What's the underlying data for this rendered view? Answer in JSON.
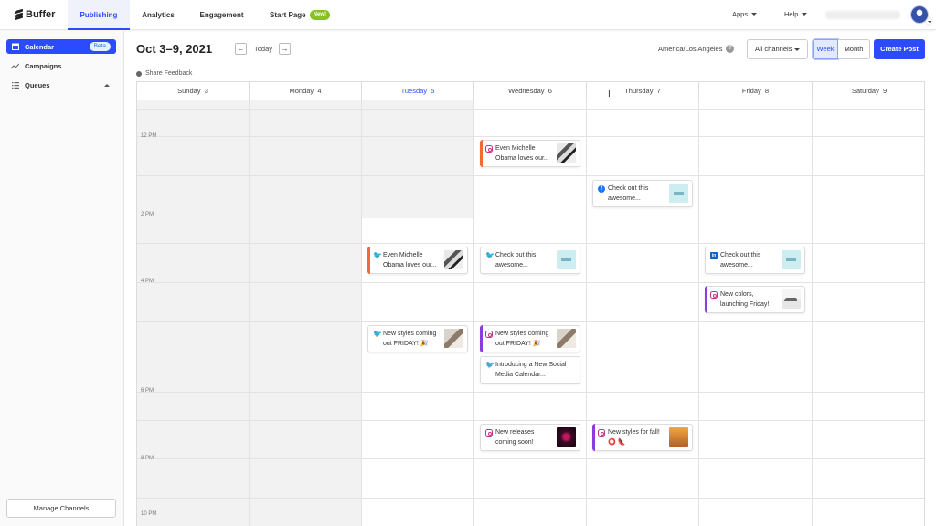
{
  "nav": {
    "logo": "Buffer",
    "tabs": [
      "Publishing",
      "Analytics",
      "Engagement",
      "Start Page"
    ],
    "new_badge": "New!",
    "apps": "Apps",
    "help": "Help"
  },
  "sidebar": {
    "items": [
      {
        "label": "Calendar",
        "badge": "Beta"
      },
      {
        "label": "Campaigns"
      },
      {
        "label": "Queues"
      }
    ],
    "manage": "Manage Channels"
  },
  "header": {
    "date_range": "Oct 3–9, 2021",
    "prev": "←",
    "next": "→",
    "today": "Today",
    "timezone": "America/Los Angeles",
    "channels": "All channels",
    "week": "Week",
    "month": "Month",
    "create": "Create Post",
    "feedback": "Share Feedback"
  },
  "days": [
    {
      "name": "Sunday",
      "num": "3"
    },
    {
      "name": "Monday",
      "num": "4"
    },
    {
      "name": "Tuesday",
      "num": "5"
    },
    {
      "name": "Wednesday",
      "num": "6"
    },
    {
      "name": "Thursday",
      "num": "7"
    },
    {
      "name": "Friday",
      "num": "8"
    },
    {
      "name": "Saturday",
      "num": "9"
    }
  ],
  "times": [
    "12 PM",
    "2 PM",
    "4 PM",
    "6 PM",
    "8 PM",
    "10 PM"
  ],
  "posts": [
    {
      "text": "Even Michelle Obama loves our...",
      "network": "instagram"
    },
    {
      "text": "Check out this awesome...",
      "network": "facebook"
    },
    {
      "text": "Even Michelle Obama loves our...",
      "network": "twitter"
    },
    {
      "text": "Check out this awesome...",
      "network": "twitter"
    },
    {
      "text": "Check out this awesome...",
      "network": "linkedin"
    },
    {
      "text": "New colors, launching Friday!",
      "network": "instagram"
    },
    {
      "text": "New styles coming out FRIDAY! 🎉",
      "network": "twitter"
    },
    {
      "text": "New styles coming out FRIDAY! 🎉",
      "network": "instagram"
    },
    {
      "text": "Introducing a New Social Media Calendar...",
      "network": "twitter"
    },
    {
      "text": "New releases coming soon!",
      "network": "instagram"
    },
    {
      "text": "New styles for fall! ⭕ 👠",
      "network": "instagram"
    }
  ],
  "colors": {
    "accent": "#2c4bff",
    "stripe_orange": "#f26b35",
    "stripe_purple": "#8a3ce0",
    "new_badge": "#87c221"
  }
}
